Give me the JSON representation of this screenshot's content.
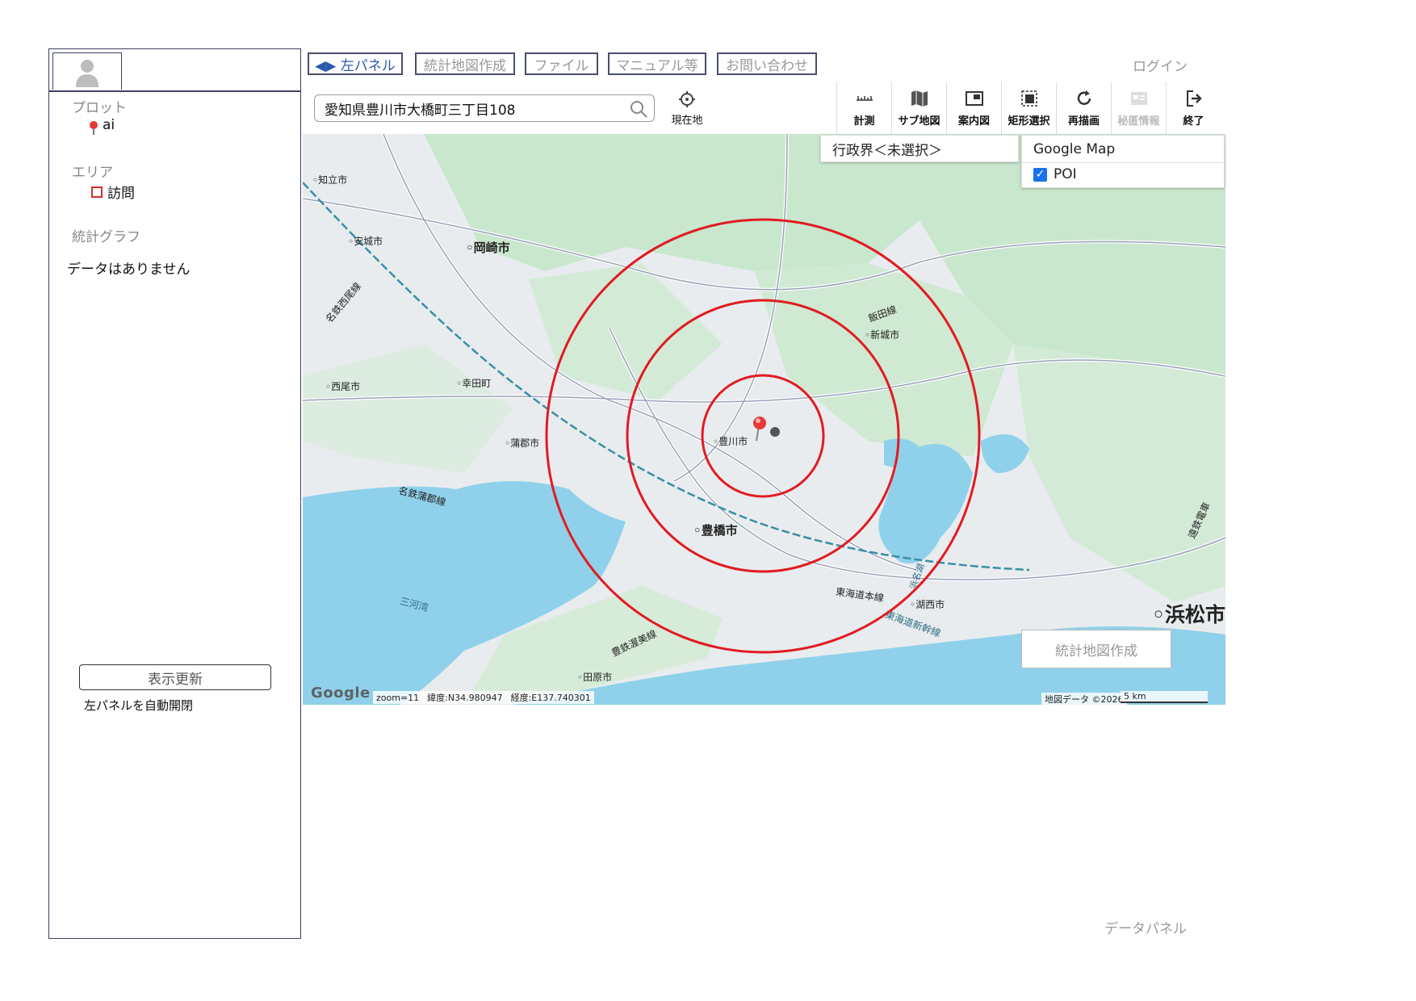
{
  "left_panel": {
    "plot_label": "プロット",
    "plot_item": "ai",
    "area_label": "エリア",
    "area_item": "訪問",
    "graph_label": "統計グラフ",
    "no_data": "データはありません",
    "refresh_button": "表示更新",
    "auto_toggle": "左パネルを自動開閉"
  },
  "top_menu": {
    "left_panel": "◀▶ 左パネル",
    "stat_map": "統計地図作成",
    "file": "ファイル",
    "manual": "マニュアル等",
    "contact": "お問い合わせ",
    "login": "ログイン"
  },
  "search": {
    "value": "愛知県豊川市大橋町三丁目108",
    "current_location": "現在地"
  },
  "toolbar": [
    {
      "label": "計測",
      "icon": "ruler-icon",
      "enabled": true
    },
    {
      "label": "サブ地図",
      "icon": "map-icon",
      "enabled": true
    },
    {
      "label": "案内図",
      "icon": "guide-map-icon",
      "enabled": true
    },
    {
      "label": "矩形選択",
      "icon": "rect-select-icon",
      "enabled": true
    },
    {
      "label": "再描画",
      "icon": "refresh-icon",
      "enabled": true
    },
    {
      "label": "秘匿情報",
      "icon": "hidden-info-icon",
      "enabled": false
    },
    {
      "label": "終了",
      "icon": "exit-icon",
      "enabled": true
    }
  ],
  "map": {
    "admin_selector": "行政界＜未選択＞",
    "layer_title": "Google Map",
    "poi_label": "POI",
    "poi_checked": true,
    "stat_button": "統計地図作成",
    "zoom": "zoom=11",
    "lat": "緯度:N34.980947",
    "lng": "経度:E137.740301",
    "copyright": "地図データ ©2026",
    "scale": "5 km",
    "google": "Google",
    "places": {
      "okazaki": "岡崎市",
      "toyokawa": "豊川市",
      "toyohashi": "豊橋市",
      "hamamatsu": "浜松市",
      "chiryu": "知立市",
      "anjo": "安城市",
      "nishio": "西尾市",
      "kota": "幸田町",
      "gamagori": "蒲郡市",
      "shinshiro": "新城市",
      "kosai": "湖西市",
      "tahara": "田原市",
      "mikawa_bay": "三河湾",
      "hamana": "浜名湖",
      "iida_line": "飯田線",
      "tokaido_line": "東海道本線",
      "shinkansen": "東海道新幹線",
      "meitetsu_gamagori": "名鉄蒲郡線",
      "meitetsu_nishio": "名鉄西尾線",
      "toyotetsu": "豊鉄渥美線",
      "entetsu": "遠鉄電車"
    },
    "colors": {
      "land": "#e8ecee",
      "green": "#c9e7cd",
      "water": "#8fd1ea",
      "circle": "#e11b22",
      "road": "#ffffff"
    }
  },
  "data_panel": "データパネル"
}
